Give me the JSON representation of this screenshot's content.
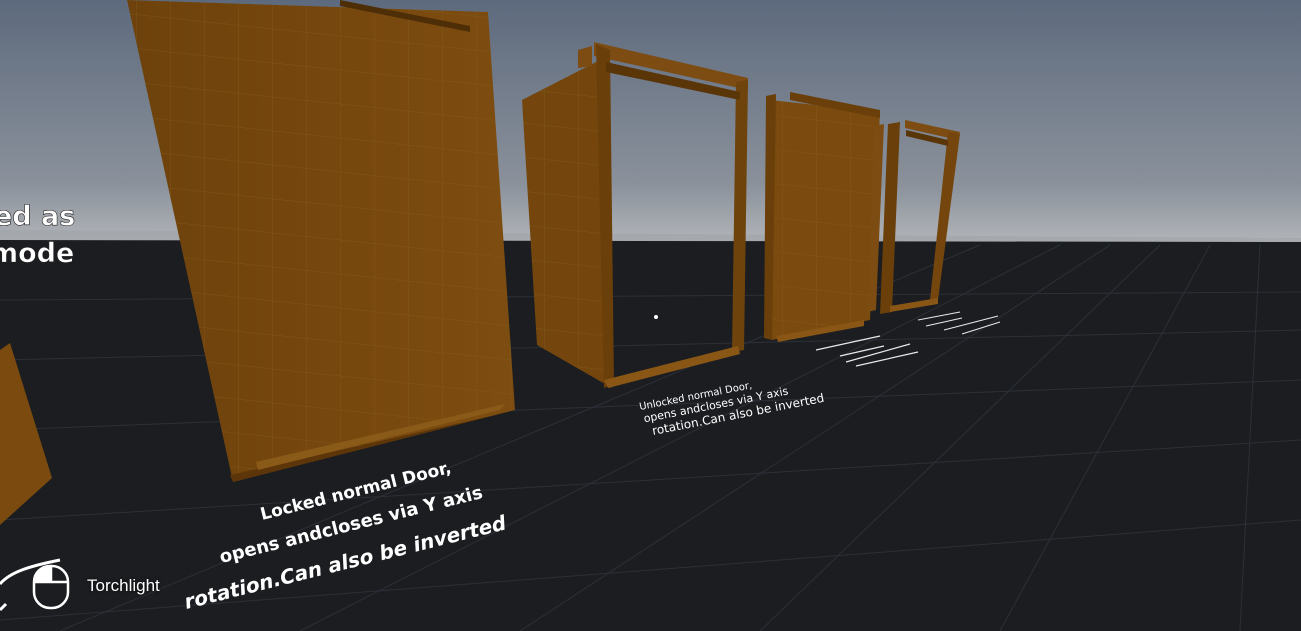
{
  "hud": {
    "action_label": "Torchlight",
    "icon": "mouse-icon"
  },
  "signs": {
    "left_partial": [
      "ed as",
      "mode"
    ],
    "locked_door": [
      "Locked  normal Door,",
      "opens andcloses via Y axis",
      "rotation.Can also be inverted"
    ],
    "unlocked_door": [
      "Unlocked  normal Door,",
      "opens andcloses via Y axis",
      "rotation.Can also be inverted"
    ]
  },
  "colors": {
    "sky_top": "#5e6a7c",
    "sky_horizon": "#a9adb3",
    "floor": "#1b1d21",
    "grid_line": "#2a2e34",
    "door_wood": "#7a4a0e",
    "door_dark": "#5c3608",
    "text": "#ffffff"
  }
}
